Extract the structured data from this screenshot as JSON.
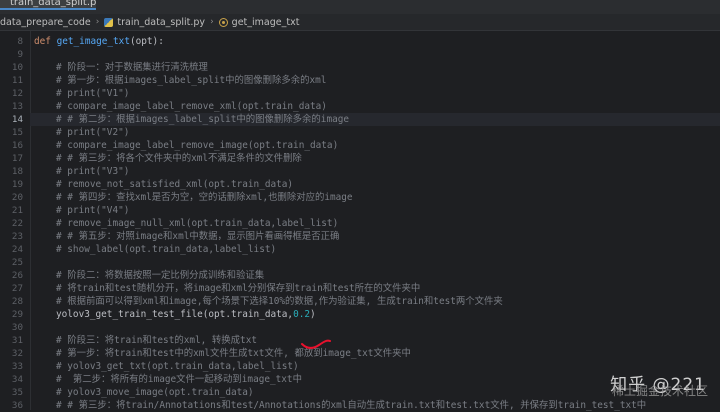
{
  "tab": {
    "label": "train_data_split.py"
  },
  "breadcrumb": {
    "folder": "data_prepare_code",
    "file": "train_data_split.py",
    "func": "get_image_txt"
  },
  "lines": [
    {
      "n": "8",
      "kind": "def",
      "def_kw": "def",
      "def_name": "get_image_txt",
      "def_rest": "(opt):"
    },
    {
      "n": "9",
      "kind": "blank",
      "text": ""
    },
    {
      "n": "10",
      "kind": "cmt",
      "text": "# 阶段一：对于数据集进行清洗梳理"
    },
    {
      "n": "11",
      "kind": "cmt",
      "text": "# 第一步：根据images_label_split中的图像删除多余的xml"
    },
    {
      "n": "12",
      "kind": "cmt",
      "text": "# print(\"V1\")"
    },
    {
      "n": "13",
      "kind": "cmt",
      "text": "# compare_image_label_remove_xml(opt.train_data)"
    },
    {
      "n": "14",
      "kind": "cmt",
      "current": true,
      "text": "# # 第二步：根据images_label_split中的图像删除多余的image"
    },
    {
      "n": "15",
      "kind": "cmt",
      "text": "# print(\"V2\")"
    },
    {
      "n": "16",
      "kind": "cmt",
      "text": "# compare_image_label_remove_image(opt.train_data)"
    },
    {
      "n": "17",
      "kind": "cmt",
      "text": "# # 第三步：将各个文件夹中的xml不满足条件的文件删除"
    },
    {
      "n": "18",
      "kind": "cmt",
      "text": "# print(\"V3\")"
    },
    {
      "n": "19",
      "kind": "cmt",
      "text": "# remove_not_satisfied_xml(opt.train_data)"
    },
    {
      "n": "20",
      "kind": "cmt",
      "text": "# # 第四步：查找xml是否为空，空的话删除xml,也删除对应的image"
    },
    {
      "n": "21",
      "kind": "cmt",
      "text": "# print(\"V4\")"
    },
    {
      "n": "22",
      "kind": "cmt",
      "text": "# remove_image_null_xml(opt.train_data,label_list)"
    },
    {
      "n": "23",
      "kind": "cmt",
      "text": "# # 第五步：对照image和xml中数据，显示图片看画得框是否正确"
    },
    {
      "n": "24",
      "kind": "cmt",
      "text": "# show_label(opt.train_data,label_list)"
    },
    {
      "n": "25",
      "kind": "blank",
      "text": ""
    },
    {
      "n": "26",
      "kind": "cmt",
      "text": "# 阶段二：将数据按照一定比例分成训练和验证集"
    },
    {
      "n": "27",
      "kind": "cmt",
      "text": "# 将train和test随机分开，将image和xml分别保存到train和test所在的文件夹中"
    },
    {
      "n": "28",
      "kind": "cmt",
      "text": "# 根据前面可以得到xml和image,每个场景下选择10%的数据,作为验证集, 生成train和test两个文件夹"
    },
    {
      "n": "29",
      "kind": "call",
      "fn": "yolov3_get_train_test_file",
      "args": "(opt.train_data,",
      "num": "0.2",
      "close": ")"
    },
    {
      "n": "30",
      "kind": "blank",
      "text": ""
    },
    {
      "n": "31",
      "kind": "cmt",
      "text": "# 阶段三：将train和test的xml, 转换成txt"
    },
    {
      "n": "32",
      "kind": "cmt",
      "text": "# 第一步：将train和test中的xml文件生成txt文件, 都放到image_txt文件夹中"
    },
    {
      "n": "33",
      "kind": "cmt",
      "text": "# yolov3_get_txt(opt.train_data,label_list)"
    },
    {
      "n": "34",
      "kind": "cmt",
      "text": "#  第二步：将所有的image文件一起移动到image_txt中"
    },
    {
      "n": "35",
      "kind": "cmt",
      "text": "# yolov3_move_image(opt.train_data)"
    },
    {
      "n": "36",
      "kind": "cmt",
      "text": "# # 第三步：将train/Annotations和test/Annotations的xml自动生成train.txt和test.txt文件, 并保存到train_test_txt中"
    }
  ],
  "watermark": {
    "text": "知乎 @221",
    "sub": "稀土掘金技术社区"
  },
  "colors": {
    "background": "#1e1f22",
    "comment": "#7a7e85",
    "keyword": "#cf8e6d",
    "function": "#56a8f5",
    "number": "#2aacb8",
    "annotation": "#e8112d"
  }
}
